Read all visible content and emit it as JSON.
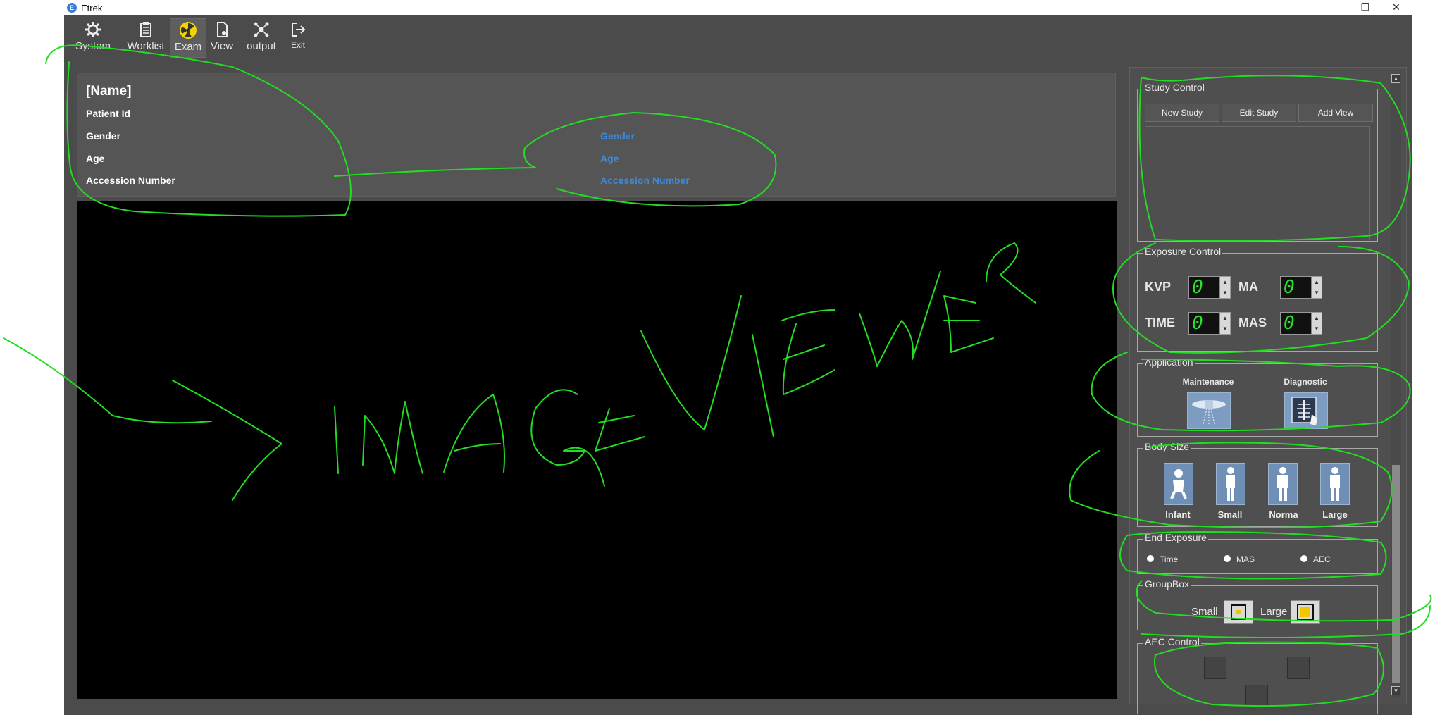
{
  "window": {
    "title": "Etrek",
    "app_icon": "E",
    "minimize": "—",
    "maximize": "❐",
    "close": "✕"
  },
  "toolbar": {
    "items": [
      {
        "label": "System",
        "icon": "gear-icon"
      },
      {
        "label": "Worklist",
        "icon": "clipboard-icon"
      },
      {
        "label": "Exam",
        "icon": "radiation-icon"
      },
      {
        "label": "View",
        "icon": "document-icon"
      },
      {
        "label": "output",
        "icon": "network-icon"
      },
      {
        "label": "Exit",
        "icon": "exit-icon"
      }
    ],
    "active": "Exam"
  },
  "patient": {
    "name": "[Name]",
    "labels": {
      "patient_id": "Patient Id",
      "gender": "Gender",
      "age": "Age",
      "accession": "Accession Number"
    },
    "values": {
      "gender": "Gender",
      "age": "Age",
      "accession": "Accession Number"
    },
    "value_color": "#3f8ad8"
  },
  "study_control": {
    "title": "Study Control",
    "new_study": "New Study",
    "edit_study": "Edit Study",
    "add_view": "Add View"
  },
  "exposure_control": {
    "title": "Exposure Control",
    "kvp_label": "KVP",
    "ma_label": "MA",
    "time_label": "TIME",
    "mas_label": "MAS",
    "kvp": "0",
    "ma": "0",
    "time": "0",
    "mas": "0",
    "display_color": "#2ee02e"
  },
  "application": {
    "title": "Application",
    "maintenance": "Maintenance",
    "diagnostic": "Diagnostic"
  },
  "body_size": {
    "title": "Body Size",
    "infant": "Infant",
    "small": "Small",
    "normal": "Norma",
    "large": "Large"
  },
  "end_exposure": {
    "title": "End Exposure",
    "time": "Time",
    "mas": "MAS",
    "aec": "AEC"
  },
  "group_box": {
    "title": "GroupBox",
    "small": "Small",
    "large": "Large",
    "large_color": "#f5c400"
  },
  "aec_control": {
    "title": "AEC Control"
  },
  "annotation": {
    "text": "IMAGEVIEWER",
    "color": "#22dd22"
  }
}
